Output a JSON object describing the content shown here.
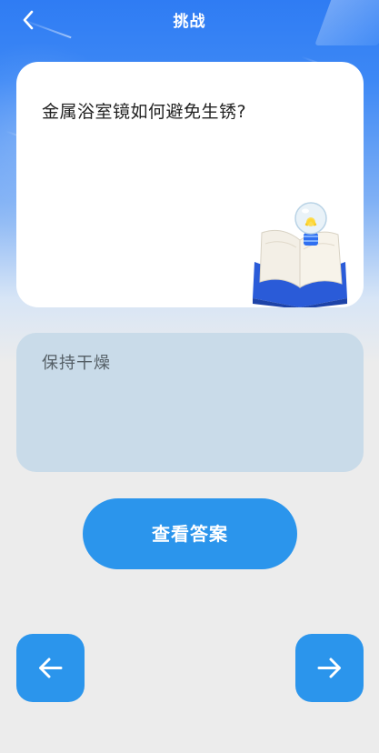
{
  "header": {
    "title": "挑战",
    "back_icon": "chevron-left-icon"
  },
  "question": {
    "text": "金属浴室镜如何避免生锈?",
    "illustration": "book-lightbulb-illustration"
  },
  "answer": {
    "text": "保持干燥"
  },
  "actions": {
    "show_answer_label": "查看答案",
    "prev_icon": "arrow-left-icon",
    "next_icon": "arrow-right-icon"
  },
  "colors": {
    "primary": "#2b95ec",
    "header_gradient_top": "#2f7cf3",
    "answer_background": "#c9dbe9",
    "page_background": "#ececec"
  }
}
